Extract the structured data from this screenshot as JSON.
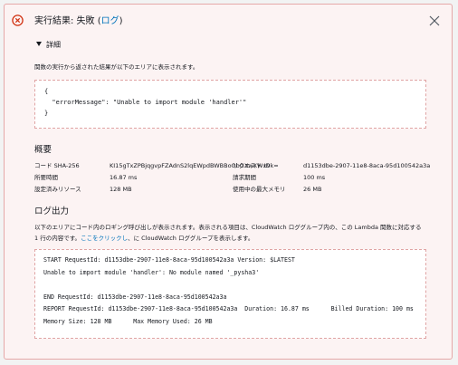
{
  "header": {
    "title_prefix": "実行結果: 失敗 (",
    "log_link": "ログ",
    "title_suffix": ")",
    "details_toggle": "詳細"
  },
  "details": {
    "description": "関数の実行から返された結果が以下のエリアに表示されます。",
    "result_lines": [
      "{",
      "  \"errorMessage\": \"Unable to import module 'handler'\"",
      "}"
    ]
  },
  "summary": {
    "heading": "概要",
    "code_sha_label": "コード SHA-256",
    "code_sha_value": "KI15gTxZPBjqgvpFZAdnS2lqEWpdBWBBoObGXwXWx9k=",
    "request_id_label": "リクエスト ID",
    "request_id_value": "d1153dbe-2907-11e8-8aca-95d100542a3a",
    "duration_label": "所要時間",
    "duration_value": "16.87 ms",
    "billed_label": "請求期間",
    "billed_value": "100 ms",
    "resources_label": "設定済みリソース",
    "resources_value": "128 MB",
    "max_memory_label": "使用中の最大メモリ",
    "max_memory_value": "26 MB"
  },
  "log": {
    "heading": "ログ出力",
    "description_line1": "以下のエリアにコード内のロギング呼び出しが表示されます。表示される項目は、CloudWatch ロググループ内の、この Lambda 関数に対応する",
    "description_line2_prefix": "1 行の内容です。",
    "link": "ここをクリックし",
    "description_line2_suffix": "、に CloudWatch ロググループを表示します。",
    "lines": [
      "START RequestId: d1153dbe-2907-11e8-8aca-95d100542a3a Version: $LATEST",
      "Unable to import module 'handler': No module named '_pysha3'",
      "",
      "END RequestId: d1153dbe-2907-11e8-8aca-95d100542a3a",
      "REPORT RequestId: d1153dbe-2907-11e8-8aca-95d100542a3a  Duration: 16.87 ms      Billed Duration: 100 ms",
      "Memory Size: 128 MB      Max Memory Used: 26 MB"
    ]
  },
  "colors": {
    "error": "#d13212",
    "link": "#0073bb",
    "panel_bg": "#fcf3f3",
    "panel_border": "#e6a8a8"
  }
}
